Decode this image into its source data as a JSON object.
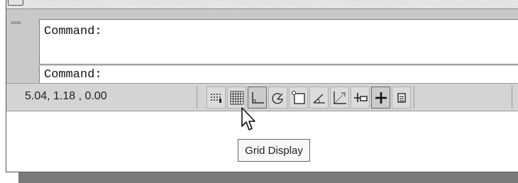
{
  "command_line": {
    "history_prompt": "Command:",
    "input_prompt": "Command:"
  },
  "status_bar": {
    "coordinates": "5.04, 1.18 , 0.00",
    "buttons": [
      {
        "icon": "snap-mode-icon",
        "state": "off"
      },
      {
        "icon": "grid-display-icon",
        "state": "off"
      },
      {
        "icon": "ortho-mode-icon",
        "state": "on"
      },
      {
        "icon": "polar-tracking-icon",
        "state": "off"
      },
      {
        "icon": "object-snap-icon",
        "state": "off"
      },
      {
        "icon": "object-snap-tracking-icon",
        "state": "off"
      },
      {
        "icon": "dynamic-ucs-icon",
        "state": "off"
      },
      {
        "icon": "dynamic-input-icon",
        "state": "off"
      },
      {
        "icon": "lineweight-icon",
        "state": "on"
      },
      {
        "icon": "quick-properties-icon",
        "state": "off"
      }
    ]
  },
  "tooltip": {
    "text": "Grid Display"
  }
}
